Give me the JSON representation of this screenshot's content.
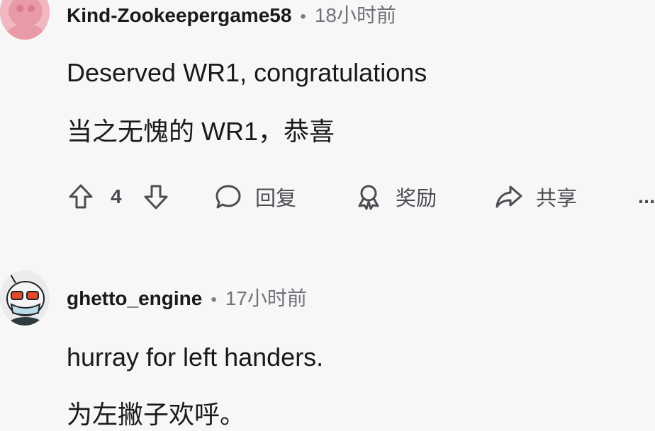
{
  "comments": [
    {
      "username": "Kind-Zookeepergame58",
      "separator": "•",
      "time": "18小时前",
      "body_en": "Deserved WR1, congratulations",
      "body_zh": "当之无愧的 WR1，恭喜",
      "votes": "4",
      "actions": {
        "reply": "回复",
        "award": "奖励",
        "share": "共享",
        "more": "..."
      }
    },
    {
      "username": "ghetto_engine",
      "separator": "•",
      "time": "17小时前",
      "body_en": "hurray for left handers.",
      "body_zh": "为左撇子欢呼。"
    }
  ],
  "icons": {
    "upvote": "arrow-up-icon",
    "downvote": "arrow-down-icon",
    "reply": "speech-bubble-icon",
    "award": "award-ribbon-icon",
    "share": "share-arrow-icon",
    "more": "more-dots-icon"
  },
  "colors": {
    "background": "#f7f7f8",
    "text": "#1a1a1b",
    "meta": "#6f7378",
    "icon": "#4a4d52"
  }
}
